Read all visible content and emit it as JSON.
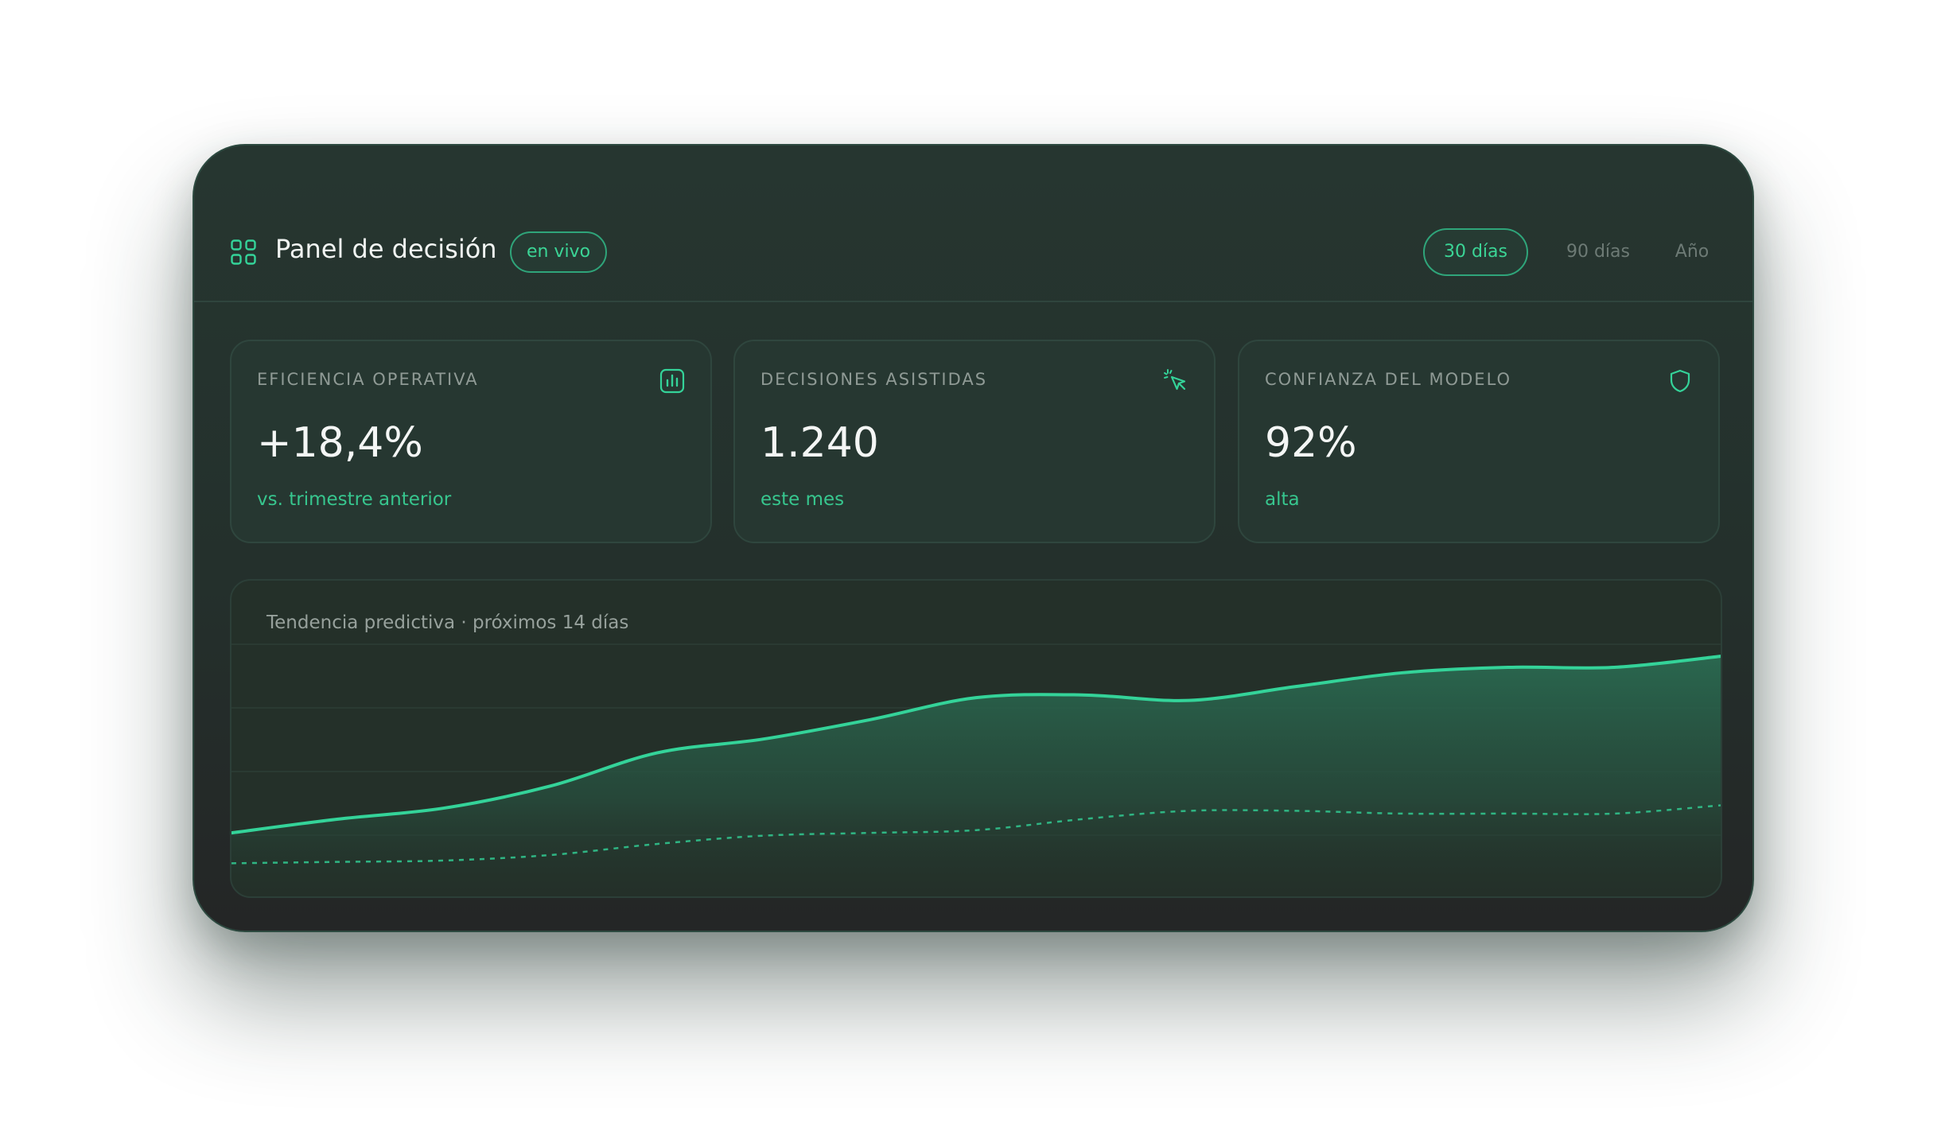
{
  "header": {
    "title": "Panel de decisión",
    "live_badge": "en vivo",
    "range_tabs": [
      "30 días",
      "90 días",
      "Año"
    ],
    "active_range": "30 días"
  },
  "kpis": [
    {
      "label": "EFICIENCIA OPERATIVA",
      "value": "+18,4%",
      "sub": "vs. trimestre anterior",
      "icon": "bar-chart-icon"
    },
    {
      "label": "DECISIONES ASISTIDAS",
      "value": "1.240",
      "sub": "este mes",
      "icon": "cursor-click-icon"
    },
    {
      "label": "CONFIANZA DEL MODELO",
      "value": "92%",
      "sub": "alta",
      "icon": "shield-icon"
    }
  ],
  "colors": {
    "accent": "#34d399",
    "card_bg": "#263630",
    "muted_text": "#6d7a75"
  },
  "chart_data": {
    "type": "area",
    "title": "Tendencia predictiva · próximos 14 días",
    "xlabel": "",
    "ylabel": "",
    "x": [
      0,
      1,
      2,
      3,
      4,
      5,
      6,
      7,
      8,
      9,
      10,
      11,
      12,
      13,
      14
    ],
    "ylim": [
      0,
      100
    ],
    "grid": true,
    "series": [
      {
        "style": "solid-area",
        "values": [
          23,
          28,
          32,
          40,
          52,
          57,
          64,
          72,
          73,
          71,
          76,
          81,
          83,
          83,
          87
        ]
      },
      {
        "style": "dashed",
        "values": [
          12,
          12.5,
          13,
          15,
          19,
          22,
          23,
          24,
          28,
          31,
          31,
          30,
          30,
          30,
          33
        ]
      }
    ]
  }
}
